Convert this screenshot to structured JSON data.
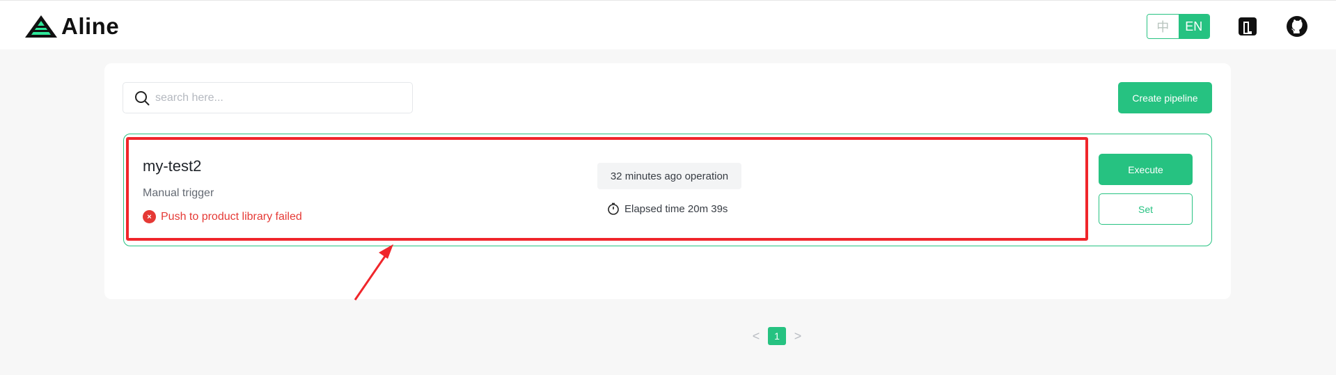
{
  "app": {
    "name": "Aline"
  },
  "header": {
    "lang_options": [
      {
        "label": "中",
        "active": false
      },
      {
        "label": "EN",
        "active": true
      }
    ],
    "icons": [
      "notion-icon",
      "github-icon"
    ]
  },
  "toolbar": {
    "search_placeholder": "search here...",
    "create_label": "Create pipeline"
  },
  "pipeline": {
    "name": "my-test2",
    "trigger": "Manual trigger",
    "status_text": "Push to product library failed",
    "status_icon": "×",
    "last_operation": "32 minutes ago operation",
    "elapsed": "Elapsed time 20m 39s",
    "execute_label": "Execute",
    "set_label": "Set"
  },
  "pagination": {
    "prev": "<",
    "current": "1",
    "next": ">"
  },
  "colors": {
    "accent": "#26c281",
    "error": "#e53935",
    "annotation": "#f0262b",
    "background": "#f7f7f7"
  }
}
